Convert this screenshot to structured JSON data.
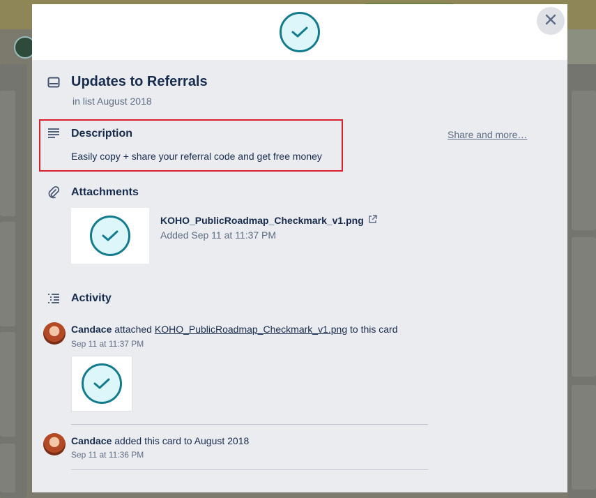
{
  "card": {
    "title": "Updates to Referrals",
    "list_prefix": "in list",
    "list_name": "August 2018"
  },
  "description": {
    "heading": "Description",
    "text": "Easily copy + share your referral code and get free money"
  },
  "sidebar": {
    "share_label": "Share and more…"
  },
  "attachments": {
    "heading": "Attachments",
    "items": [
      {
        "file_name": "KOHO_PublicRoadmap_Checkmark_v1.png",
        "added": "Added Sep 11 at 11:37 PM"
      }
    ]
  },
  "activity": {
    "heading": "Activity",
    "items": [
      {
        "user": "Candace",
        "action": "attached",
        "link": "KOHO_PublicRoadmap_Checkmark_v1.png",
        "suffix": "to this card",
        "time": "Sep 11 at 11:37 PM"
      },
      {
        "user": "Candace",
        "action": "added this card to August 2018",
        "time": "Sep 11 at 11:36 PM"
      }
    ]
  },
  "icons": {
    "close": "close-icon",
    "card": "card-icon",
    "description": "description-icon",
    "attachment": "paperclip-icon",
    "activity": "activity-icon",
    "external": "external-link-icon",
    "checkmark": "checkmark-icon"
  },
  "colors": {
    "accent_teal": "#137c8c",
    "check_fill": "#dcf6fa",
    "highlight_red": "#d8202c",
    "modal_bg": "#ebecf0",
    "text_primary": "#172b4d",
    "text_secondary": "#5e6c84"
  }
}
